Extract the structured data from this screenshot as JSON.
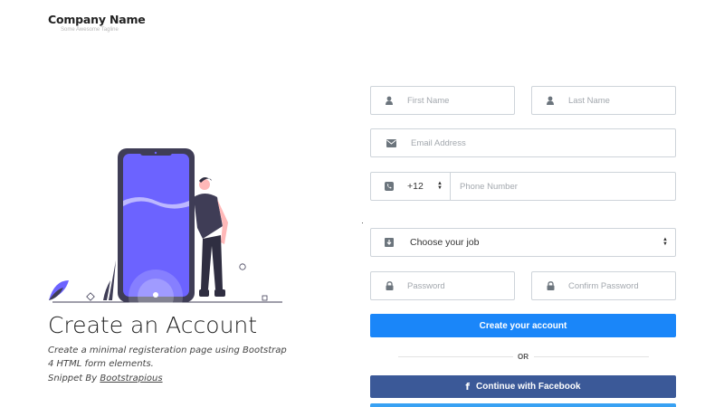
{
  "brand": {
    "name": "Company Name",
    "tagline": "Some Awesome Tagline"
  },
  "hero": {
    "title": "Create an Account",
    "description": "Create a minimal registeration page using Bootstrap 4 HTML form elements.",
    "snippet_prefix": "Snippet By ",
    "snippet_link": "Bootstrapious"
  },
  "form": {
    "first_name_placeholder": "First Name",
    "last_name_placeholder": "Last Name",
    "email_placeholder": "Email Address",
    "phone_code": "+12",
    "phone_placeholder": "Phone Number",
    "job_selected": "Choose your job",
    "password_placeholder": "Password",
    "confirm_password_placeholder": "Confirm Password",
    "submit_label": "Create your account",
    "divider_text": "OR",
    "facebook_label": "Continue with Facebook"
  },
  "icons": {
    "user": "user-icon",
    "email": "envelope-icon",
    "phone": "phone-icon",
    "job": "briefcase-icon",
    "lock": "lock-icon",
    "facebook": "facebook-icon"
  },
  "colors": {
    "primary": "#1a86f9",
    "facebook": "#3b5998",
    "twitter": "#38a1f3",
    "illustration_purple": "#6c63ff"
  }
}
